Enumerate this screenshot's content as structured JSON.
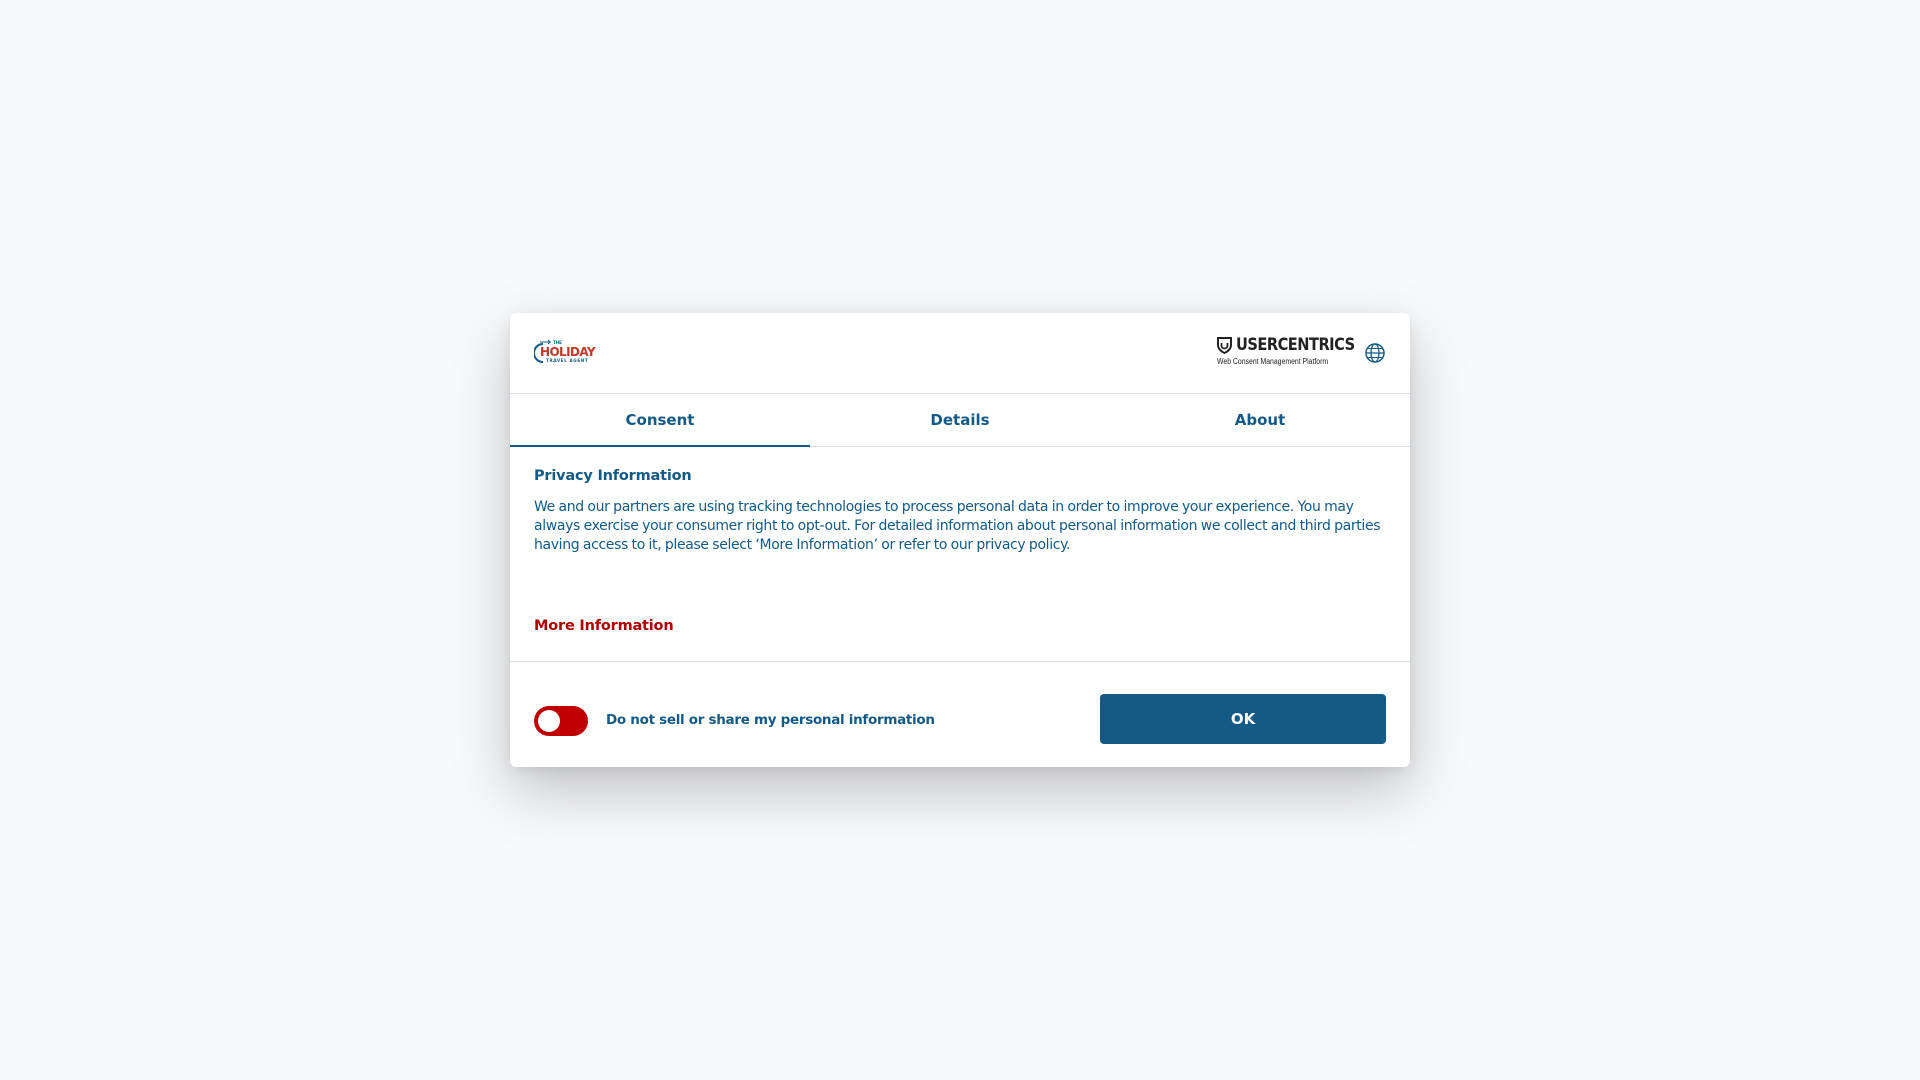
{
  "brand": {
    "logo_small_text": "THE",
    "logo_main_text": "HOLIDAY",
    "logo_sub_text": "TRAVEL AGENT",
    "primary_color": "#135a86",
    "accent_color": "#c0392b"
  },
  "cmp": {
    "logo_title": "USERCENTRICS",
    "logo_subtitle": "Web Consent Management Platform",
    "language_icon": "globe-icon"
  },
  "tabs": [
    {
      "label": "Consent",
      "active": true
    },
    {
      "label": "Details",
      "active": false
    },
    {
      "label": "About",
      "active": false
    }
  ],
  "content": {
    "title": "Privacy Information",
    "text": "We and our partners are using tracking technologies to process personal data in order to improve your experience. You may always exercise your consumer right to opt-out. For detailed information about personal information we collect and third parties having access to it, please select ‘More Information’ or refer to our privacy policy.",
    "more_info_label": "More Information",
    "more_info_color": "#b00000"
  },
  "footer": {
    "toggle_label": "Do not sell or share my personal information",
    "toggle_on": true,
    "toggle_color": "#c00000",
    "ok_label": "OK"
  }
}
